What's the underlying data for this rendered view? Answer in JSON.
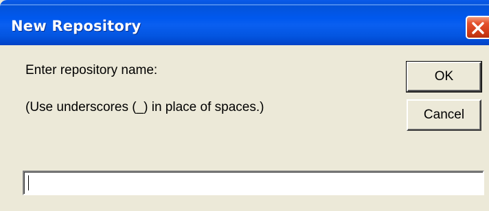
{
  "window": {
    "title": "New Repository",
    "close_icon": "close-icon",
    "colors": {
      "titlebar": "#0058EE",
      "face": "#ECE9D8",
      "close_button": "#D23E1A"
    }
  },
  "dialog": {
    "prompt_label": "Enter repository name:",
    "hint_label": "(Use underscores (_) in place of spaces.)",
    "ok_label": "OK",
    "cancel_label": "Cancel",
    "name_input": {
      "value": "",
      "placeholder": ""
    }
  }
}
